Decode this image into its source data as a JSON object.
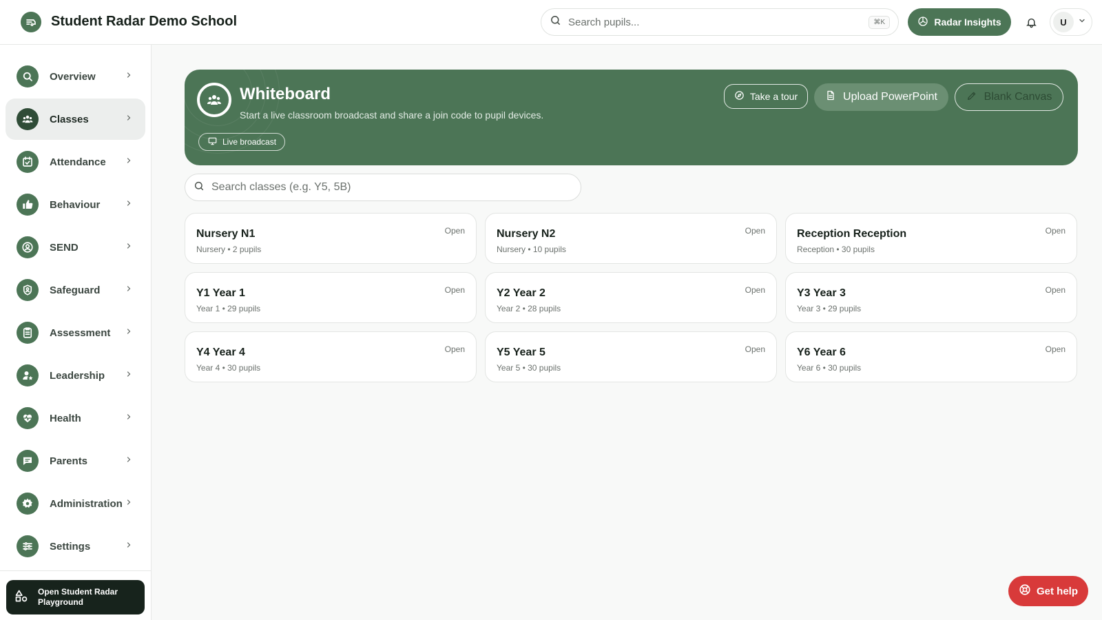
{
  "app": {
    "title": "Student Radar Demo School"
  },
  "header": {
    "search_placeholder": "Search pupils...",
    "shortcut": "⌘K",
    "insights_label": "Radar Insights",
    "user_initial": "U"
  },
  "sidebar": {
    "items": [
      {
        "label": "Overview",
        "icon": "search-icon",
        "active": false
      },
      {
        "label": "Classes",
        "icon": "users-icon",
        "active": true
      },
      {
        "label": "Attendance",
        "icon": "calendar-check-icon",
        "active": false
      },
      {
        "label": "Behaviour",
        "icon": "thumbs-up-icon",
        "active": false
      },
      {
        "label": "SEND",
        "icon": "user-circle-icon",
        "active": false
      },
      {
        "label": "Safeguard",
        "icon": "shield-user-icon",
        "active": false
      },
      {
        "label": "Assessment",
        "icon": "clipboard-icon",
        "active": false
      },
      {
        "label": "Leadership",
        "icon": "user-star-icon",
        "active": false
      },
      {
        "label": "Health",
        "icon": "heart-pulse-icon",
        "active": false
      },
      {
        "label": "Parents",
        "icon": "chat-icon",
        "active": false
      },
      {
        "label": "Administration",
        "icon": "gear-icon",
        "active": false
      },
      {
        "label": "Settings",
        "icon": "sliders-icon",
        "active": false
      }
    ],
    "playground_label": "Open Student Radar Playground"
  },
  "whiteboard": {
    "title": "Whiteboard",
    "subtitle": "Start a live classroom broadcast and share a join code to pupil devices.",
    "live_label": "Live broadcast",
    "tour_label": "Take a tour",
    "upload_label": "Upload PowerPoint",
    "canvas_label": "Blank Canvas"
  },
  "class_search": {
    "placeholder": "Search classes (e.g. Y5, 5B)"
  },
  "classes": [
    {
      "name": "Nursery N1",
      "meta": "Nursery • 2 pupils",
      "status": "Open"
    },
    {
      "name": "Nursery N2",
      "meta": "Nursery • 10 pupils",
      "status": "Open"
    },
    {
      "name": "Reception Reception",
      "meta": "Reception • 30 pupils",
      "status": "Open"
    },
    {
      "name": "Y1 Year 1",
      "meta": "Year 1 • 29 pupils",
      "status": "Open"
    },
    {
      "name": "Y2 Year 2",
      "meta": "Year 2 • 28 pupils",
      "status": "Open"
    },
    {
      "name": "Y3 Year 3",
      "meta": "Year 3 • 29 pupils",
      "status": "Open"
    },
    {
      "name": "Y4 Year 4",
      "meta": "Year 4 • 30 pupils",
      "status": "Open"
    },
    {
      "name": "Y5 Year 5",
      "meta": "Year 5 • 30 pupils",
      "status": "Open"
    },
    {
      "name": "Y6 Year 6",
      "meta": "Year 6 • 30 pupils",
      "status": "Open"
    }
  ],
  "help": {
    "label": "Get help"
  },
  "colors": {
    "brand": "#4c7556",
    "help": "#d83a3a",
    "dark": "#17231c"
  }
}
